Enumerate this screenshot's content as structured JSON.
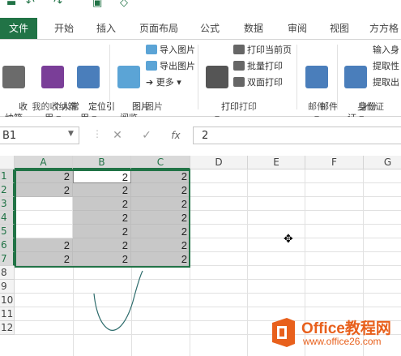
{
  "tabs": [
    "文件",
    "开始",
    "插入",
    "页面布局",
    "公式",
    "数据",
    "审阅",
    "视图",
    "方方格"
  ],
  "ribbon": {
    "groups": {
      "mycollection": {
        "label": "我的收纳箱",
        "b1": "收\n纳箱",
        "b2": "个人常\n用 ▾",
        "b3": "定位引\n用 ▾"
      },
      "picture": {
        "label": "图片",
        "big": "图片\n阅览",
        "s1": "导入图片",
        "s2": "导出图片",
        "s3": "➔ 更多 ▾"
      },
      "print": {
        "label": "打印",
        "big": "打印\n▾",
        "s1": "打印当前页",
        "s2": "批量打印",
        "s3": "双面打印"
      },
      "mail": {
        "label": "邮件",
        "big": "邮件\n▾"
      },
      "idcard": {
        "label": "身份证",
        "big": "身份\n证 ▾",
        "s1": "输入身",
        "s2": "提取性",
        "s3": "提取出"
      }
    }
  },
  "formula_bar": {
    "name_box": "B1",
    "fx": "fx",
    "value": "2"
  },
  "grid": {
    "columns": [
      "A",
      "B",
      "C",
      "D",
      "E",
      "F",
      "G"
    ],
    "rows": [
      "1",
      "2",
      "3",
      "4",
      "5",
      "6",
      "7",
      "8",
      "9",
      "10",
      "11",
      "12"
    ],
    "cells": [
      [
        "2",
        "2",
        "2"
      ],
      [
        "2",
        "2",
        "2"
      ],
      [
        "",
        "2",
        "2"
      ],
      [
        "",
        "2",
        "2"
      ],
      [
        "",
        "2",
        "2"
      ],
      [
        "2",
        "2",
        "2"
      ],
      [
        "2",
        "2",
        "2"
      ]
    ]
  },
  "watermark": {
    "title": "Office教程网",
    "url": "www.office26.com"
  },
  "colors": {
    "accent": "#217346",
    "highlight": "#c8c8c8",
    "watermark": "#e8601c"
  }
}
